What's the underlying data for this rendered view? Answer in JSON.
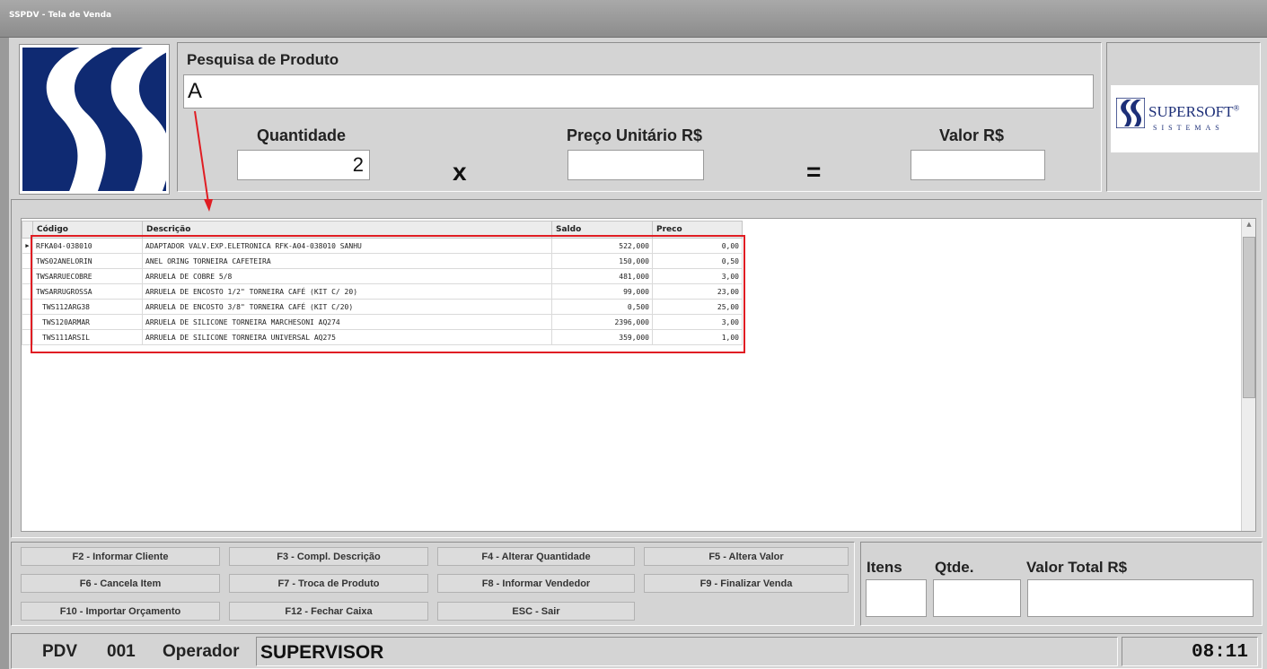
{
  "window": {
    "title": "SSPDV - Tela de Venda"
  },
  "search": {
    "label": "Pesquisa de Produto",
    "value": "A"
  },
  "fields": {
    "quantity_label": "Quantidade",
    "quantity_value": "2",
    "unit_price_label": "Preço Unitário R$",
    "unit_price_value": "",
    "total_value_label": "Valor R$",
    "total_value_value": "",
    "multiply_symbol": "x",
    "equals_symbol": "="
  },
  "brand": {
    "name": "SUPERSOFT",
    "registered": "®",
    "subtitle": "SISTEMAS"
  },
  "grid": {
    "columns": [
      "Código",
      "Descrição",
      "Saldo",
      "Preco"
    ],
    "rows": [
      {
        "code": "RFKA04-038010",
        "description": "ADAPTADOR VALV.EXP.ELETRONICA RFK-A04-038010 SANHU",
        "saldo": "522,000",
        "preco": "0,00"
      },
      {
        "code": "TWS02ANELORIN",
        "description": "ANEL ORING TORNEIRA CAFETEIRA",
        "saldo": "150,000",
        "preco": "0,50"
      },
      {
        "code": "TWSARRUECOBRE",
        "description": "ARRUELA DE COBRE 5/8",
        "saldo": "481,000",
        "preco": "3,00"
      },
      {
        "code": "TWSARRUGROSSA",
        "description": "ARRUELA DE ENCOSTO 1/2\" TORNEIRA CAFÉ (KIT C/ 20)",
        "saldo": "99,000",
        "preco": "23,00"
      },
      {
        "code": "TWS112ARG38",
        "description": "ARRUELA DE ENCOSTO 3/8\" TORNEIRA CAFÉ (KIT C/20)",
        "saldo": "0,500",
        "preco": "25,00"
      },
      {
        "code": "TWS120ARMAR",
        "description": "ARRUELA DE SILICONE TORNEIRA MARCHESONI AQ274",
        "saldo": "2396,000",
        "preco": "3,00"
      },
      {
        "code": "TWS111ARSIL",
        "description": "ARRUELA DE SILICONE TORNEIRA UNIVERSAL AQ275",
        "saldo": "359,000",
        "preco": "1,00"
      }
    ]
  },
  "function_keys": [
    "F2 - Informar Cliente",
    "F3 - Compl. Descrição",
    "F4 - Alterar Quantidade",
    "F5 - Altera Valor",
    "F6 - Cancela Item",
    "F7 - Troca de Produto",
    "F8 - Informar Vendedor",
    "F9 - Finalizar Venda",
    "F10 - Importar Orçamento",
    "F12 - Fechar Caixa",
    "ESC - Sair"
  ],
  "totals": {
    "items_label": "Itens",
    "items_value": "",
    "qty_label": "Qtde.",
    "qty_value": "",
    "total_label": "Valor Total R$",
    "total_value": ""
  },
  "status": {
    "pdv_label": "PDV",
    "pdv_number": "001",
    "operator_label": "Operador",
    "operator_name": "SUPERVISOR",
    "clock": "08:11"
  },
  "colors": {
    "logo_blue": "#0f2a72",
    "brand_blue": "#1d2f78",
    "highlight_red": "#e01d23",
    "background": "#d4d4d4"
  }
}
